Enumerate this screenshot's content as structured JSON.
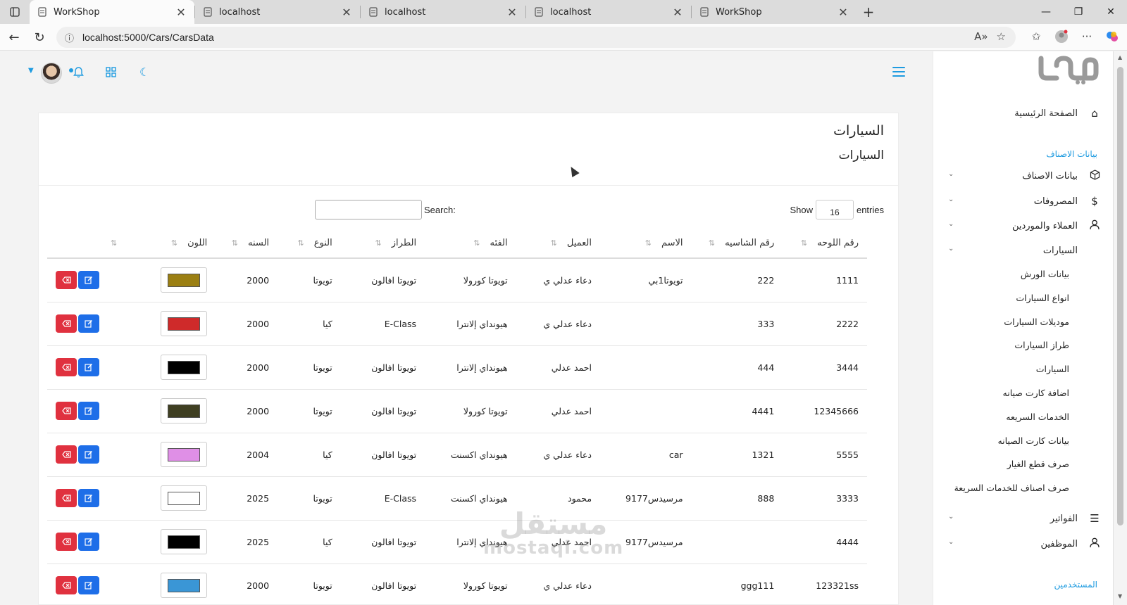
{
  "browser": {
    "tabs": [
      {
        "title": "WorkShop",
        "active": true
      },
      {
        "title": "localhost",
        "active": false
      },
      {
        "title": "localhost",
        "active": false
      },
      {
        "title": "localhost",
        "active": false
      },
      {
        "title": "WorkShop",
        "active": false
      }
    ],
    "url": "localhost:5000/Cars/CarsData",
    "new_tab_glyph": "+",
    "close_glyph": "✕"
  },
  "sidebar": {
    "logo_text": "موف",
    "home_label": "الصفحة الرئيسية",
    "section_heading": "بيانات الاصناف",
    "groups": [
      {
        "label": "بيانات الاصناف",
        "icon": "box-icon"
      },
      {
        "label": "المصروفات",
        "icon": "dollar-icon"
      },
      {
        "label": "العملاء والموردين",
        "icon": "user-icon"
      },
      {
        "label": "السيارات",
        "icon": ""
      }
    ],
    "submenu": [
      "بيانات الورش",
      "انواع السيارات",
      "موديلات السيارات",
      "طراز السيارات",
      "السيارات",
      "اضافة كارت صيانه",
      "الخدمات السريعه",
      "بيانات كارت الصيانه",
      "صرف قطع الغيار",
      "صرف اصناف للخدمات السريعة"
    ],
    "bottom_groups": [
      {
        "label": "الفواتير",
        "icon": "list-icon"
      },
      {
        "label": "الموظفين",
        "icon": "user-icon"
      }
    ],
    "bottom_heading": "المستخدمين"
  },
  "page": {
    "title": "السيارات",
    "subtitle": "السيارات",
    "show_label": "Show",
    "entries_label": "entries",
    "entries_value": "16",
    "search_label": "Search:",
    "search_value": ""
  },
  "table": {
    "columns": [
      "رقم اللوحه",
      "رقم الشاسيه",
      "الاسم",
      "العميل",
      "الفئه",
      "الطراز",
      "النوع",
      "السنه",
      "اللون",
      ""
    ],
    "rows": [
      {
        "plate": "1111",
        "chassis": "222",
        "name": "تويوتا1بي",
        "client": "دعاء عدلي ي",
        "category": "تويوتا كورولا",
        "model": "تويوتا افالون",
        "type": "تويوتا",
        "year": "2000",
        "color": "#9b7f12"
      },
      {
        "plate": "2222",
        "chassis": "333",
        "name": "",
        "client": "دعاء عدلي ي",
        "category": "هيونداي إلانترا",
        "model": "E-Class",
        "type": "كيا",
        "year": "2000",
        "color": "#cf2a2a"
      },
      {
        "plate": "3444",
        "chassis": "444",
        "name": "",
        "client": "احمد عدلي",
        "category": "هيونداي إلانترا",
        "model": "تويوتا افالون",
        "type": "تويوتا",
        "year": "2000",
        "color": "#000000"
      },
      {
        "plate": "12345666",
        "chassis": "4441",
        "name": "",
        "client": "احمد عدلي",
        "category": "تويوتا كورولا",
        "model": "تويوتا افالون",
        "type": "تويوتا",
        "year": "2000",
        "color": "#3f3f22"
      },
      {
        "plate": "5555",
        "chassis": "1321",
        "name": "car",
        "client": "دعاء عدلي ي",
        "category": "هيونداي اكسنت",
        "model": "تويوتا افالون",
        "type": "كيا",
        "year": "2004",
        "color": "#df8fe6"
      },
      {
        "plate": "3333",
        "chassis": "888",
        "name": "مرسيدس9177",
        "client": "محمود",
        "category": "هيونداي اكسنت",
        "model": "E-Class",
        "type": "تويوتا",
        "year": "2025",
        "color": "#ffffff"
      },
      {
        "plate": "4444",
        "chassis": "",
        "name": "مرسيدس9177",
        "client": "احمد عدلي",
        "category": "هيونداي إلانترا",
        "model": "تويوتا افالون",
        "type": "كيا",
        "year": "2025",
        "color": "#000000"
      },
      {
        "plate": "123321ss",
        "chassis": "ggg111",
        "name": "",
        "client": "دعاء عدلي ي",
        "category": "تويوتا كورولا",
        "model": "تويوتا افالون",
        "type": "تويوتا",
        "year": "2000",
        "color": "#3a96d6"
      }
    ]
  },
  "watermark": {
    "line1": "مستقل",
    "line2": "mostaql.com"
  },
  "colors": {
    "accent": "#1e9be0",
    "delete": "#e0313f",
    "edit": "#1e6ee8"
  }
}
